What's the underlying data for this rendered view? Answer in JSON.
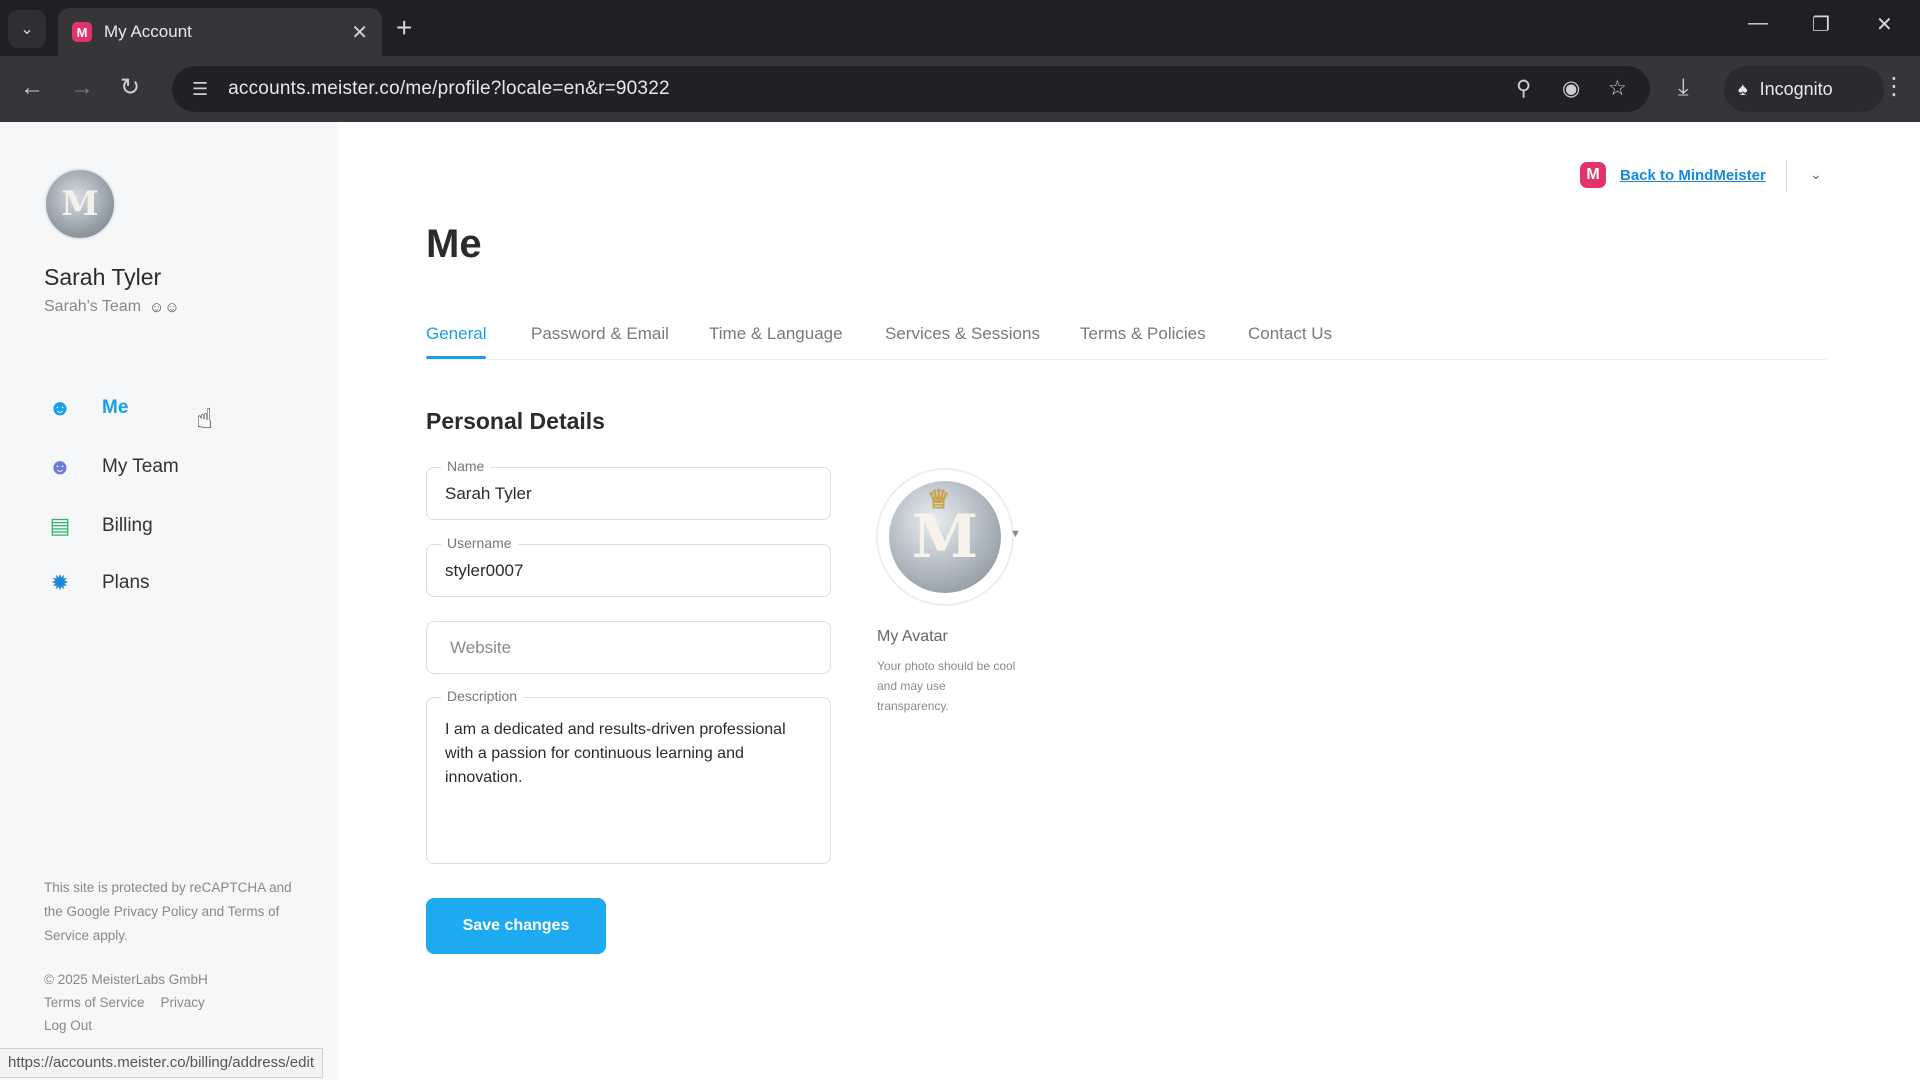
{
  "browser": {
    "tab_title": "My Account",
    "favicon_letter": "M",
    "url": "accounts.meister.co/me/profile?locale=en&r=90322",
    "incognito_label": "Incognito",
    "status_url": "https://accounts.meister.co/billing/address/edit"
  },
  "sidebar": {
    "user_name": "Sarah Tyler",
    "team_name": "Sarah's Team",
    "avatar_initial": "M",
    "items": [
      {
        "label": "Me",
        "icon": "person-card-icon",
        "active": true
      },
      {
        "label": "My Team",
        "icon": "team-icon",
        "active": false
      },
      {
        "label": "Billing",
        "icon": "billing-icon",
        "active": false
      },
      {
        "label": "Plans",
        "icon": "plans-star-icon",
        "active": false
      }
    ],
    "legal": "This site is protected by reCAPTCHA and the Google Privacy Policy and Terms of Service apply.",
    "copyright": "© 2025 MeisterLabs GmbH",
    "terms_link": "Terms of Service",
    "privacy_link": "Privacy",
    "logout_link": "Log Out"
  },
  "header": {
    "back_label": "Back to MindMeister",
    "logo_letter": "M"
  },
  "main": {
    "title": "Me",
    "tabs": [
      {
        "label": "General",
        "active": true
      },
      {
        "label": "Password & Email",
        "active": false
      },
      {
        "label": "Time & Language",
        "active": false
      },
      {
        "label": "Services & Sessions",
        "active": false
      },
      {
        "label": "Terms & Policies",
        "active": false
      },
      {
        "label": "Contact Us",
        "active": false
      }
    ],
    "section_title": "Personal Details",
    "form": {
      "name_label": "Name",
      "name_value": "Sarah Tyler",
      "username_label": "Username",
      "username_value": "styler0007",
      "website_placeholder": "Website",
      "description_label": "Description",
      "description_value": "I am a dedicated and results-driven professional with a passion for continuous learning and innovation."
    },
    "avatar": {
      "label": "My Avatar",
      "hint": "Your photo should be cool and may use transparency.",
      "initial": "M"
    },
    "save_label": "Save changes"
  },
  "colors": {
    "accent": "#1aa0e6",
    "brand": "#e2336b",
    "button": "#1eaaf1"
  }
}
